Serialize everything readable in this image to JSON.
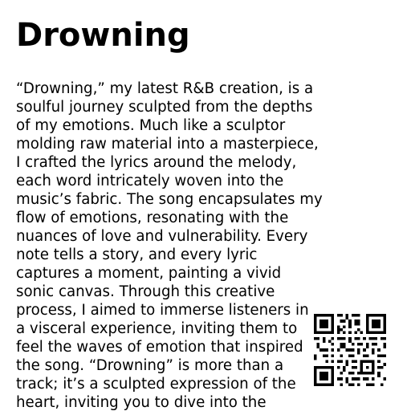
{
  "page": {
    "title": "Drowning",
    "body_lines": [
      "“Drowning,” my latest R&B creation, is a",
      "soulful journey sculpted from the depths",
      "of my emotions. Much like a sculptor",
      "molding raw material into a masterpiece,",
      "I crafted the lyrics around the melody,",
      "each word intricately woven into the",
      "music’s fabric. The song encapsulates my",
      "flow of emotions, resonating with the",
      "nuances of love and vulnerability. Every",
      "note tells a story, and every lyric",
      "captures a moment, painting a vivid",
      "sonic canvas. Through this creative",
      "process, I aimed to immerse listeners in",
      "a visceral experience, inviting them to",
      "feel the waves of emotion that inspired",
      "the song. “Drowning” is more than a",
      "track; it’s a sculpted expression of the",
      "heart, inviting you to dive into the"
    ],
    "qr_code": {
      "icon": "qr-code-icon"
    }
  }
}
